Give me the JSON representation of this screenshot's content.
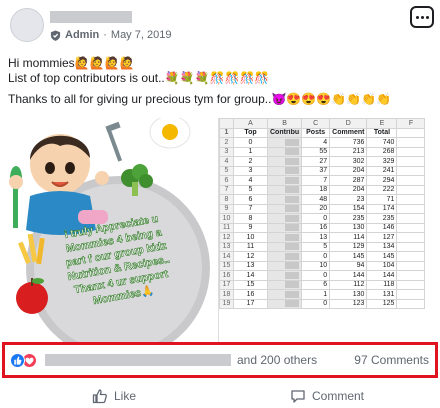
{
  "post": {
    "author_role": "Admin",
    "date": "May 7, 2019",
    "lines": [
      "Hi mommies🙋🙋🙋🙋",
      "List of top contributors is out..💐💐💐🎊🎊🎊🎊",
      "Thanks to all for giving ur precious tym for group..😈😍😍😍👏👏👏👏"
    ]
  },
  "image_left": {
    "text_lines": [
      "i truly Appreciate u",
      "Mommies 4 being a",
      "part f our group kidz",
      "Nutrition & Recipes..",
      "Thanx 4 ur support",
      "Mommies🙏"
    ]
  },
  "spreadsheet": {
    "col_letters": [
      "A",
      "B",
      "C",
      "D",
      "E",
      "F"
    ],
    "headers": [
      "Top",
      "Contribu",
      "Posts",
      "Comment",
      "Total"
    ],
    "rows": [
      [
        "0",
        "",
        "4",
        "736",
        "740"
      ],
      [
        "1",
        "",
        "55",
        "213",
        "268"
      ],
      [
        "2",
        "",
        "27",
        "302",
        "329"
      ],
      [
        "3",
        "",
        "37",
        "204",
        "241"
      ],
      [
        "4",
        "",
        "7",
        "287",
        "294"
      ],
      [
        "5",
        "",
        "18",
        "204",
        "222"
      ],
      [
        "6",
        "",
        "48",
        "23",
        "71"
      ],
      [
        "7",
        "",
        "20",
        "154",
        "174"
      ],
      [
        "8",
        "",
        "0",
        "235",
        "235"
      ],
      [
        "9",
        "",
        "16",
        "130",
        "146"
      ],
      [
        "10",
        "",
        "13",
        "114",
        "127"
      ],
      [
        "11",
        "",
        "5",
        "129",
        "134"
      ],
      [
        "12",
        "",
        "0",
        "145",
        "145"
      ],
      [
        "13",
        "",
        "10",
        "94",
        "104"
      ],
      [
        "14",
        "",
        "0",
        "144",
        "144"
      ],
      [
        "15",
        "",
        "6",
        "112",
        "118"
      ],
      [
        "16",
        "",
        "1",
        "130",
        "131"
      ],
      [
        "17",
        "",
        "0",
        "123",
        "125"
      ]
    ]
  },
  "reactions": {
    "others_text": "and 200 others",
    "comments_text": "97 Comments"
  },
  "actions": {
    "like_label": "Like",
    "comment_label": "Comment"
  },
  "colors": {
    "like_blue": "#1877f2",
    "love_red": "#f33e58",
    "highlight_red": "#e0121f"
  }
}
